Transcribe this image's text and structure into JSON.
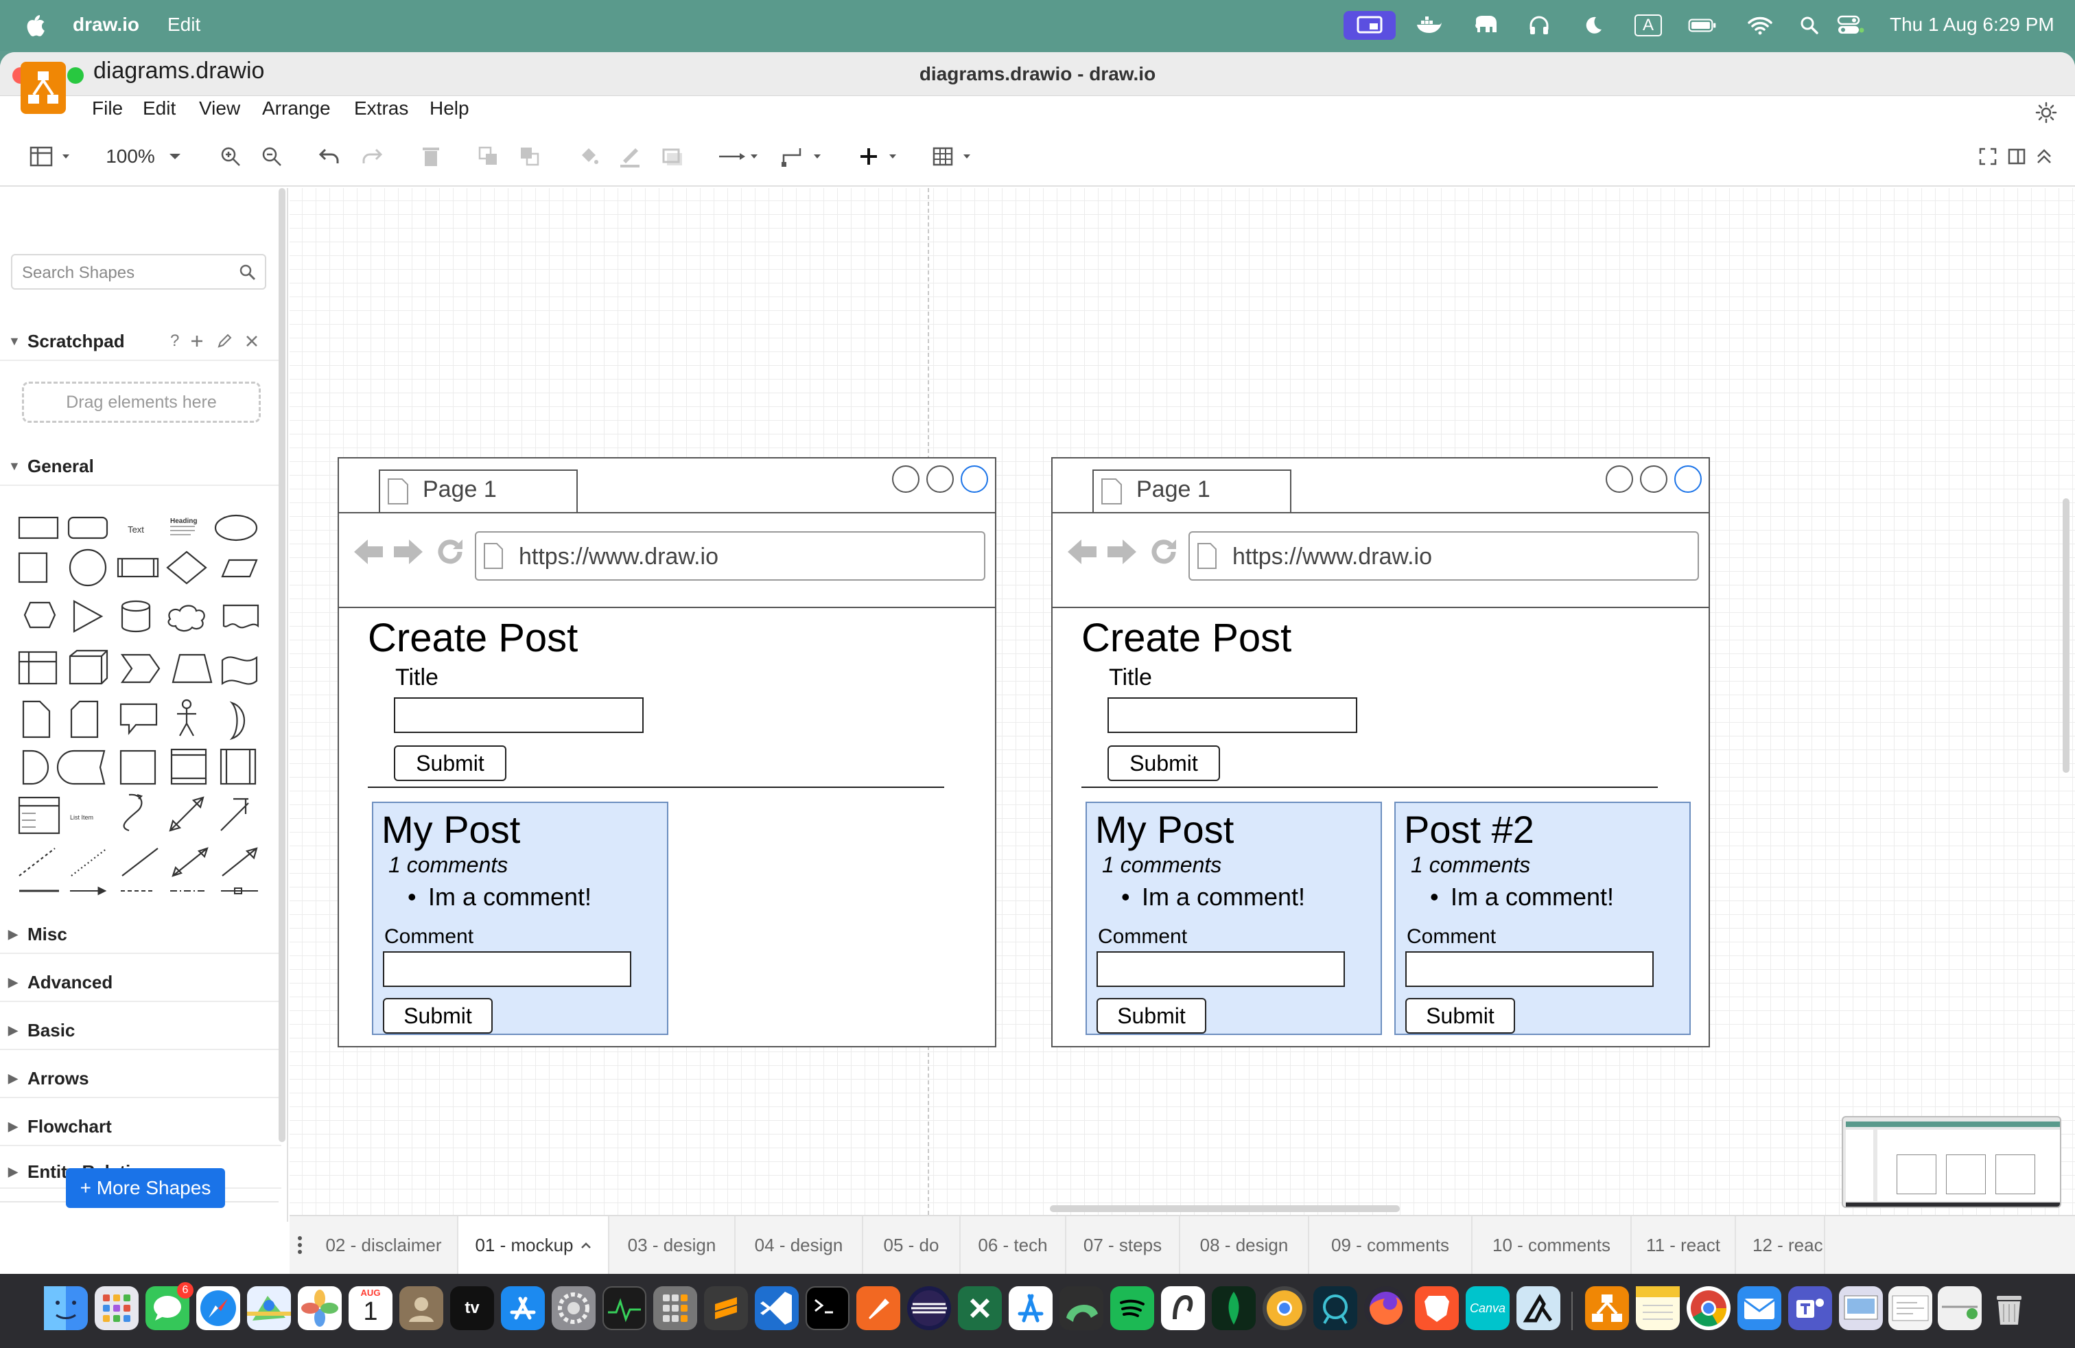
{
  "menubar": {
    "app_name": "draw.io",
    "edit_menu": "Edit",
    "clock": "Thu 1 Aug  6:29 PM",
    "input_indicator": "A"
  },
  "window": {
    "title": "diagrams.drawio - draw.io"
  },
  "header": {
    "file_name": "diagrams.drawio",
    "menus": [
      "File",
      "Edit",
      "View",
      "Arrange",
      "Extras",
      "Help"
    ]
  },
  "toolbar": {
    "zoom": "100%"
  },
  "sidebar": {
    "search_placeholder": "Search Shapes",
    "scratchpad": {
      "title": "Scratchpad",
      "help": "?",
      "drop_hint": "Drag elements here"
    },
    "general_title": "General",
    "shape_labels": {
      "text": "Text",
      "heading": "Heading",
      "list_item": "List Item"
    },
    "sections": [
      "Misc",
      "Advanced",
      "Basic",
      "Arrows",
      "Flowchart",
      "Entity Relation"
    ],
    "more_shapes": "+ More Shapes"
  },
  "mockups": [
    {
      "tab_label": "Page 1",
      "url": "https://www.draw.io",
      "heading": "Create Post",
      "title_label": "Title",
      "submit": "Submit",
      "posts": [
        {
          "title": "My Post",
          "comment_count": "1 comments",
          "comment": "Im a comment!",
          "comment_label": "Comment",
          "submit": "Submit"
        }
      ]
    },
    {
      "tab_label": "Page 1",
      "url": "https://www.draw.io",
      "heading": "Create Post",
      "title_label": "Title",
      "submit": "Submit",
      "posts": [
        {
          "title": "My Post",
          "comment_count": "1 comments",
          "comment": "Im a comment!",
          "comment_label": "Comment",
          "submit": "Submit"
        },
        {
          "title": "Post #2",
          "comment_count": "1 comments",
          "comment": "Im a comment!",
          "comment_label": "Comment",
          "submit": "Submit"
        }
      ]
    }
  ],
  "page_tabs": [
    "02 - disclaimer",
    "01 - mockup",
    "03 - design",
    "04 - design",
    "05 - do",
    "06 - tech",
    "07 - steps",
    "08 - design",
    "09 - comments",
    "10 - comments",
    "11 - react",
    "12 - reac"
  ],
  "active_tab": "01 - mockup",
  "dock": {
    "calendar_month": "AUG",
    "calendar_day": "1",
    "tv_label": "tv",
    "notification_badge": "6",
    "canva_label": "Canva"
  },
  "colors": {
    "accent": "#1a73e8",
    "logo": "#f08705",
    "card_fill": "#dae8fc",
    "card_border": "#6c8ebf",
    "menubar": "#5a9a8c"
  }
}
